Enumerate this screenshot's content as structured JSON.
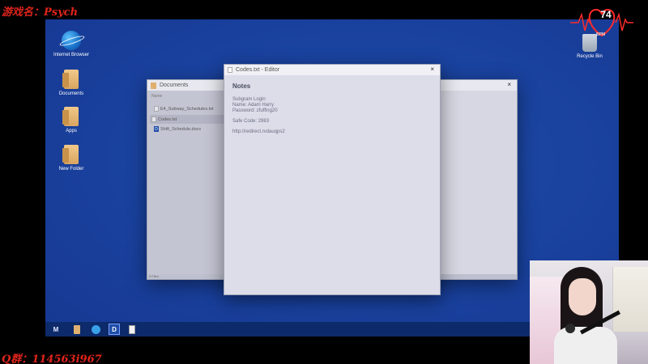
{
  "overlay": {
    "game_name": "游戏名：Psych",
    "qq_group": "Q群：114563i967"
  },
  "heart_rate": {
    "value": "74",
    "unit": "BPM"
  },
  "desktop": {
    "icons": [
      {
        "label": "Internet Browser",
        "icon": "globe-icon"
      },
      {
        "label": "Documents",
        "icon": "folder-icon"
      },
      {
        "label": "Apps",
        "icon": "folder-icon"
      },
      {
        "label": "New Folder",
        "icon": "folder-icon"
      }
    ],
    "recycle_bin": {
      "label": "Recycle Bin",
      "icon": "recycle-bin-icon"
    }
  },
  "documents_window": {
    "title": "Documents",
    "close": "×",
    "column_header": "Name",
    "files": [
      {
        "name": "E4_Subway_Schedules.txt",
        "type": "txt"
      },
      {
        "name": "Codes.txt",
        "type": "txt",
        "selected": true
      },
      {
        "name": "Shift_Schedule.docx",
        "type": "docx",
        "badge": "D"
      }
    ],
    "status": "3 Files"
  },
  "editor_window": {
    "title": "Codes.txt - Editor",
    "close": "×",
    "heading": "Notes",
    "lines": [
      "Subgram Login",
      "Name: Adam Harry",
      "Password: zfuffing20",
      "",
      "Safe Code: 2983",
      "",
      "http://redirect.rvdauqps2"
    ]
  },
  "taskbar": {
    "items": [
      {
        "icon": "start-logo-icon",
        "glyph": "M"
      },
      {
        "icon": "documents-folder-icon",
        "glyph": ""
      },
      {
        "icon": "browser-globe-icon",
        "glyph": ""
      },
      {
        "icon": "word-doc-icon",
        "glyph": "D"
      },
      {
        "icon": "text-file-icon",
        "glyph": ""
      }
    ]
  },
  "colors": {
    "desktop_blue": "#1a43a0",
    "taskbar": "#0d2a6a",
    "overlay_red": "#e0241b"
  }
}
